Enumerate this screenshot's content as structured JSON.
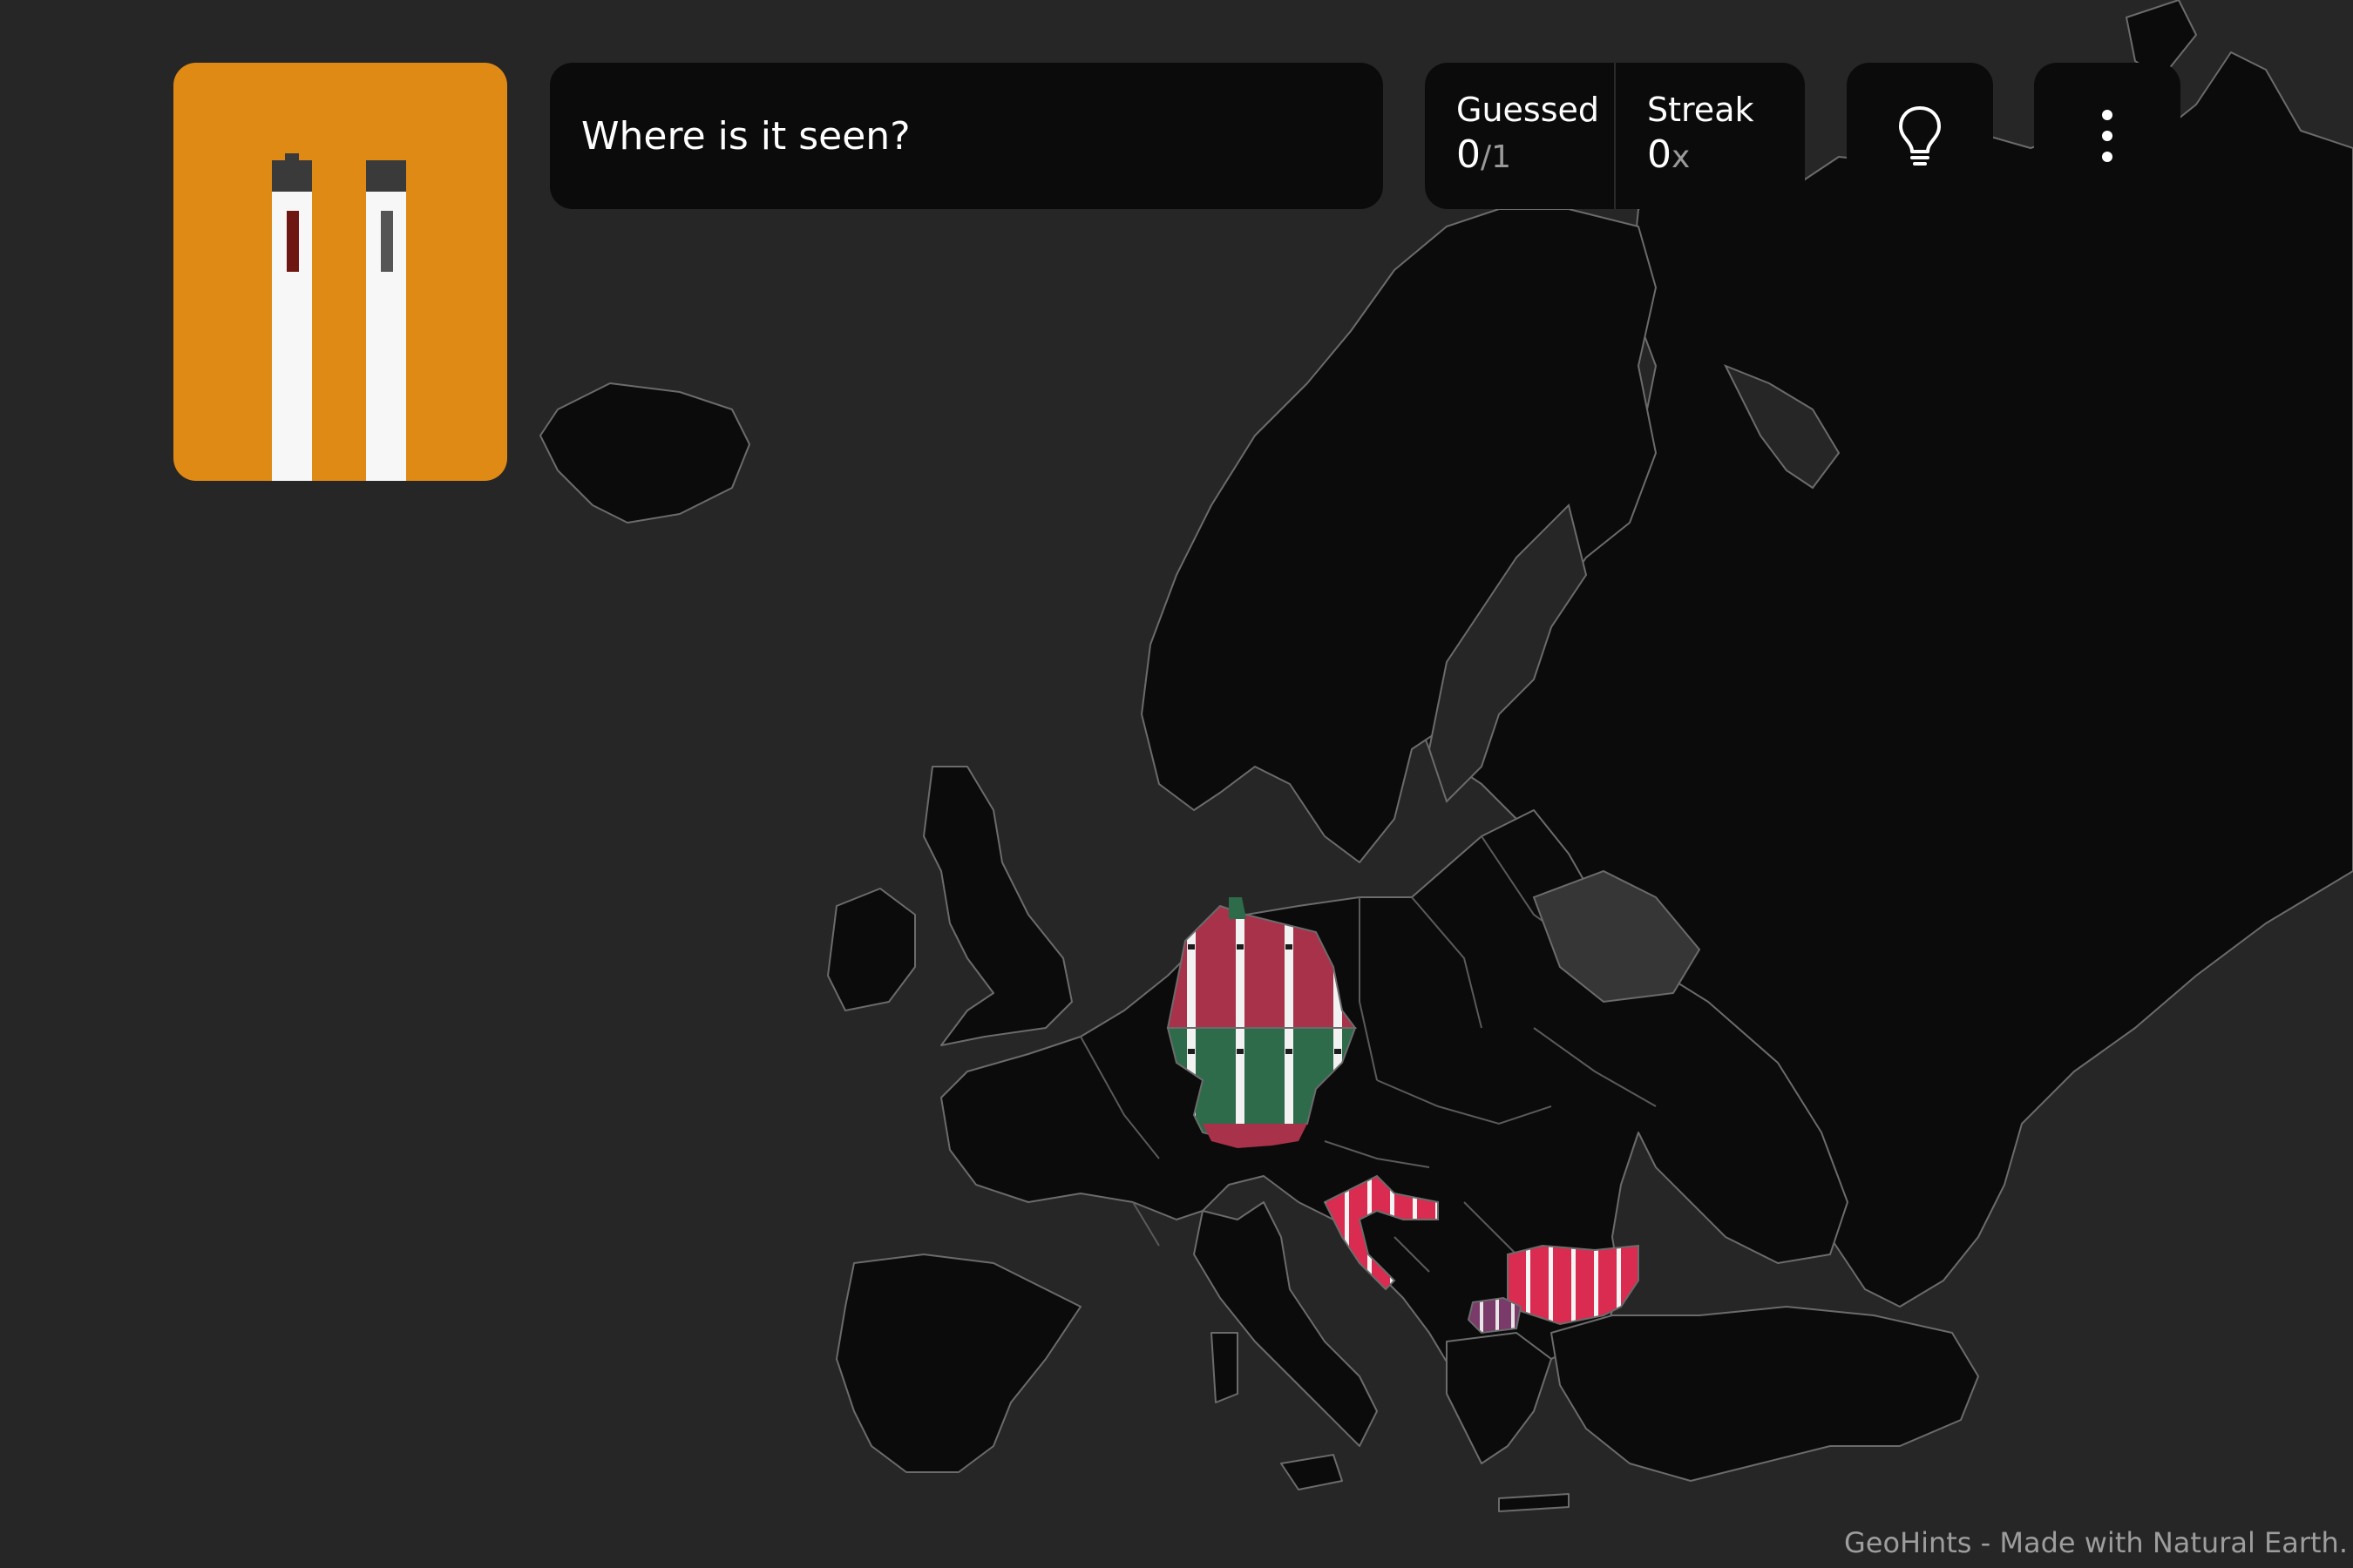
{
  "question": {
    "text": "Where is it seen?"
  },
  "score": {
    "guessed_label": "Guessed",
    "guessed_value": "0",
    "guessed_total": "/1",
    "streak_label": "Streak",
    "streak_value": "0",
    "streak_suffix": "x"
  },
  "hint_image": {
    "description_icon": "bollard-icon",
    "background": "#df8a15"
  },
  "hint_button": {
    "icon": "lightbulb-icon"
  },
  "menu_button": {
    "icon": "more-vertical-icon"
  },
  "attribution": "GeoHints - Made with Natural Earth.",
  "map": {
    "region": "Europe",
    "highlighted_countries": [
      "Germany",
      "Croatia",
      "Bulgaria",
      "North Macedonia"
    ],
    "colors": {
      "ocean": "#262626",
      "land": "#0b0b0b",
      "border": "#6b6b6b",
      "red": "#a8324a",
      "green": "#2e6b4a",
      "pink": "#d92c50"
    }
  }
}
